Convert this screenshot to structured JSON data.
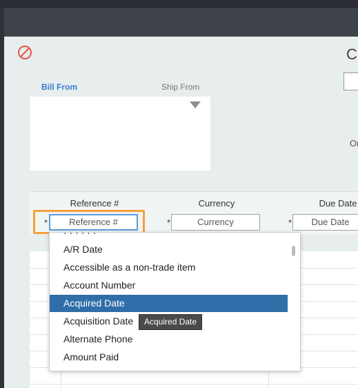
{
  "header": {
    "partial_title": "Cl",
    "partial_side_label": "Or"
  },
  "address": {
    "tabs": [
      {
        "label": "Bill From"
      },
      {
        "label": "Ship From"
      }
    ]
  },
  "fields": [
    {
      "label": "Reference #",
      "placeholder": "Reference #",
      "required_mark": "*"
    },
    {
      "label": "Currency",
      "placeholder": "Currency",
      "required_mark": "*"
    },
    {
      "label": "Due Date",
      "placeholder": "Due Date",
      "required_mark": "*"
    }
  ],
  "dropdown": {
    "partial_top_item": "A/R Date (partially visible)",
    "items": [
      {
        "label": "A/R Date"
      },
      {
        "label": "Accessible as a non-trade item"
      },
      {
        "label": "Account Number"
      },
      {
        "label": "Acquired Date"
      },
      {
        "label": "Acquisition Date"
      },
      {
        "label": "Alternate Phone"
      },
      {
        "label": "Amount Paid"
      }
    ],
    "selected_label": "Acquired Date"
  },
  "tooltip": {
    "text": "Acquired Date"
  },
  "colors": {
    "accent": "#3a7bd5",
    "focus": "#f5a03a",
    "selected": "#2f6ea8"
  }
}
